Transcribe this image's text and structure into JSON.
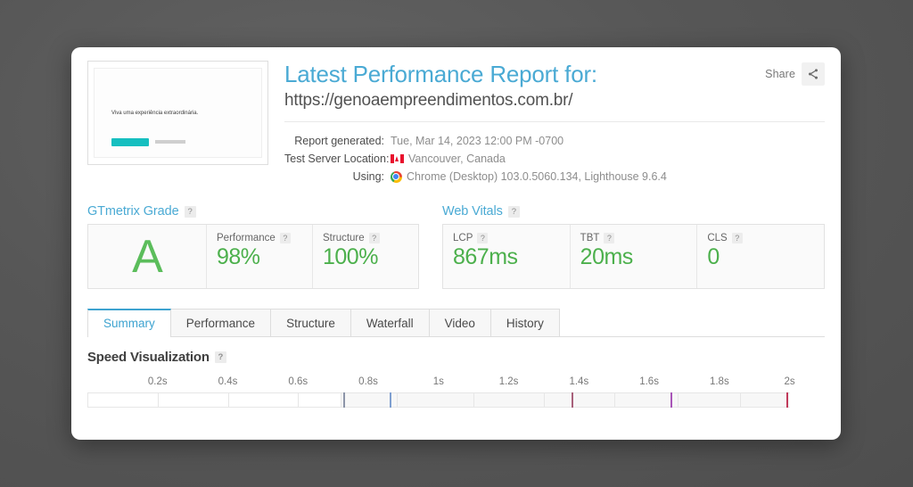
{
  "header": {
    "title": "Latest Performance Report for:",
    "url": "https://genoaempreendimentos.com.br/",
    "share_label": "Share",
    "share_icon": "share-nodes-icon"
  },
  "thumbnail": {
    "headline": "Viva uma experiência extraordinária.",
    "button_color": "#16bfc0"
  },
  "meta": [
    {
      "label": "Report generated:",
      "value": "Tue, Mar 14, 2023 12:00 PM -0700",
      "icon": ""
    },
    {
      "label": "Test Server Location:",
      "value": "Vancouver, Canada",
      "icon": "canada-flag-icon"
    },
    {
      "label": "Using:",
      "value": "Chrome (Desktop) 103.0.5060.134, Lighthouse 9.6.4",
      "icon": "chrome-icon"
    }
  ],
  "gtmetrix_grade": {
    "title": "GTmetrix Grade",
    "help": "?",
    "grade": "A",
    "metrics": [
      {
        "label": "Performance",
        "help": "?",
        "value": "98%"
      },
      {
        "label": "Structure",
        "help": "?",
        "value": "100%"
      }
    ]
  },
  "web_vitals": {
    "title": "Web Vitals",
    "help": "?",
    "metrics": [
      {
        "label": "LCP",
        "help": "?",
        "value": "867ms"
      },
      {
        "label": "TBT",
        "help": "?",
        "value": "20ms"
      },
      {
        "label": "CLS",
        "help": "?",
        "value": "0"
      }
    ]
  },
  "tabs": [
    {
      "label": "Summary",
      "active": true
    },
    {
      "label": "Performance",
      "active": false
    },
    {
      "label": "Structure",
      "active": false
    },
    {
      "label": "Waterfall",
      "active": false
    },
    {
      "label": "Video",
      "active": false
    },
    {
      "label": "History",
      "active": false
    }
  ],
  "speed_visualization": {
    "title": "Speed Visualization",
    "help": "?"
  },
  "chart_data": {
    "type": "timeline",
    "title": "Speed Visualization",
    "xlabel": "",
    "xlim": [
      0,
      2.1
    ],
    "tick_labels": [
      "0.2s",
      "0.4s",
      "0.6s",
      "0.8s",
      "1s",
      "1.2s",
      "1.4s",
      "1.6s",
      "1.8s",
      "2s"
    ],
    "tick_values": [
      0.2,
      0.4,
      0.6,
      0.8,
      1.0,
      1.2,
      1.4,
      1.6,
      1.8,
      2.0
    ],
    "frame_boundaries": [
      0.0,
      0.2,
      0.4,
      0.6,
      0.72,
      0.88,
      1.1,
      1.3,
      1.5,
      1.68,
      1.86,
      2.0
    ],
    "event_markers": [
      {
        "time": 0.73,
        "color": "#8c95a8"
      },
      {
        "time": 0.86,
        "color": "#7f9fd0"
      },
      {
        "time": 1.38,
        "color": "#a8607a"
      },
      {
        "time": 1.66,
        "color": "#a855b8"
      },
      {
        "time": 1.99,
        "color": "#c03a5a"
      }
    ],
    "colors": {
      "accent": "#4aaad4",
      "good": "#4cb04c",
      "grade": "#5bbd5b"
    }
  }
}
